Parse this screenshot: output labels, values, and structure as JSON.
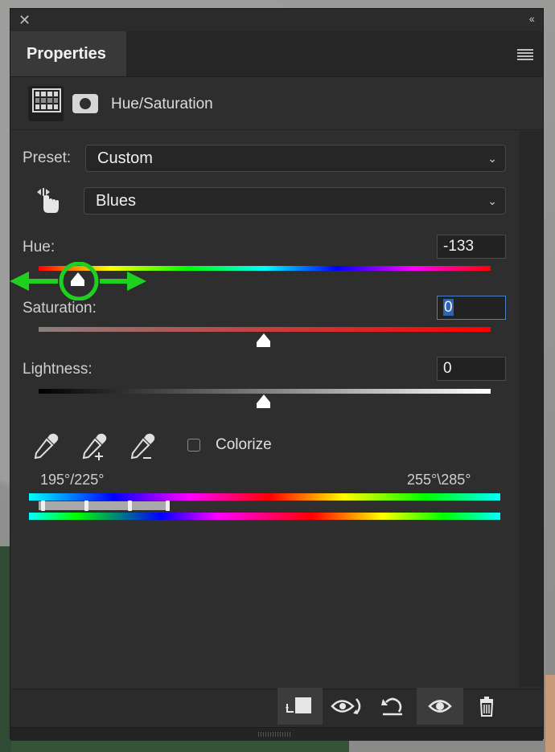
{
  "panel": {
    "tab_label": "Properties",
    "adjustment_title": "Hue/Saturation"
  },
  "preset": {
    "label": "Preset:",
    "value": "Custom"
  },
  "channel": {
    "value": "Blues"
  },
  "hue": {
    "label": "Hue:",
    "value": "-133"
  },
  "saturation": {
    "label": "Saturation:",
    "value": "0"
  },
  "lightness": {
    "label": "Lightness:",
    "value": "0"
  },
  "colorize": {
    "label": "Colorize",
    "checked": false
  },
  "range": {
    "left_text": "195°/225°",
    "right_text": "255°\\285°"
  },
  "annotation": {
    "color": "#1fd11f"
  },
  "footer": {
    "buttons": [
      "clip-to-layer",
      "view-previous-state",
      "reset",
      "toggle-visibility",
      "delete"
    ]
  },
  "icons": {
    "close": "close-icon",
    "collapse": "collapse-icon",
    "menu": "panel-menu-icon"
  },
  "colors": {
    "panel": "#2e2e2e",
    "active_field": "#2d63b3"
  }
}
